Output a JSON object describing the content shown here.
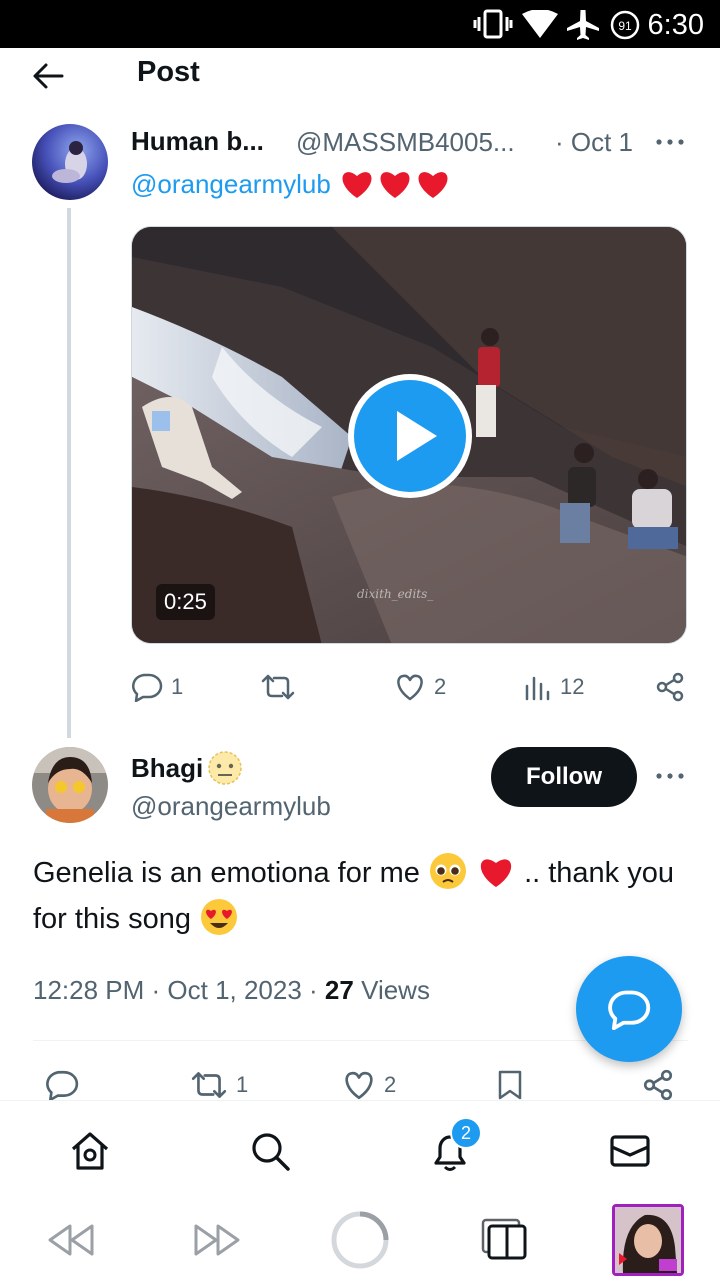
{
  "status_bar": {
    "time": "6:30",
    "battery_level": "91"
  },
  "header": {
    "title": "Post"
  },
  "original_tweet": {
    "author_name": "Human b...",
    "author_handle": "@MASSMB4005...",
    "date": "· Oct 1",
    "mention": "@orangearmylub",
    "hearts": "❤❤❤",
    "video_duration": "0:25",
    "watermark": "dixith_edits_",
    "replies": "1",
    "likes": "2",
    "views": "12"
  },
  "reply_tweet": {
    "author_name": "Bhagi",
    "author_handle": "@orangearmylub",
    "follow_label": "Follow",
    "text_part1": "Genelia is an emotiona for me ",
    "text_part2": ".. thank you for this song ",
    "timestamp": "12:28 PM · Oct 1, 2023 · ",
    "views_count": "27",
    "views_label": " Views",
    "retweets": "1",
    "likes": "2"
  },
  "bottom_nav": {
    "notifications_badge": "2"
  },
  "colors": {
    "accent": "#1d9bf0",
    "text": "#0f1419",
    "muted": "#536471",
    "heart": "#e8192c"
  }
}
